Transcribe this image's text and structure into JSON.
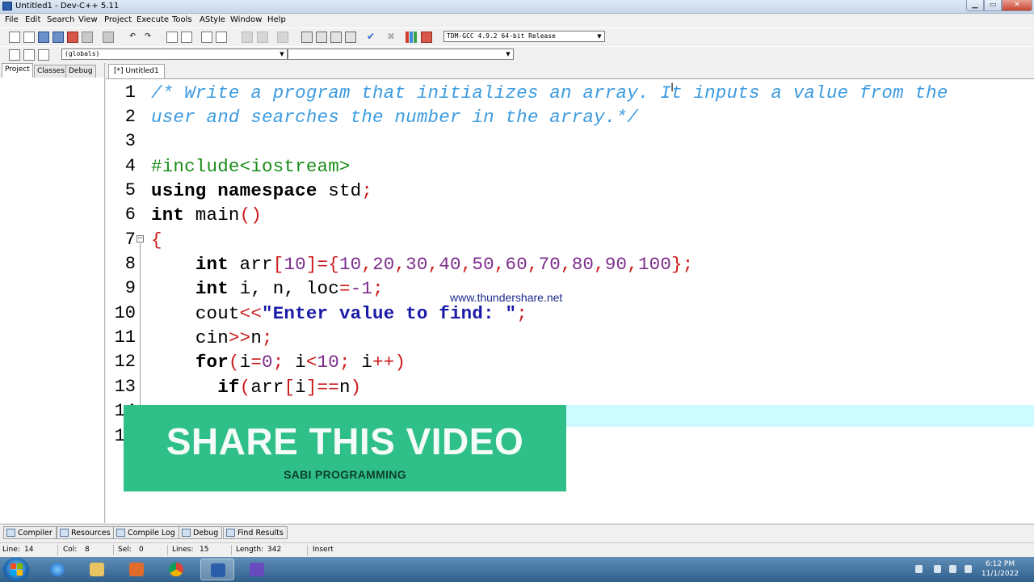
{
  "window": {
    "title": "Untitled1 - Dev-C++ 5.11"
  },
  "menu": [
    "File",
    "Edit",
    "Search",
    "View",
    "Project",
    "Execute",
    "Tools",
    "AStyle",
    "Window",
    "Help"
  ],
  "toolbar": {
    "compiler_select": "TDM-GCC 4.9.2 64-bit Release",
    "scope_select": "(globals)",
    "function_select": ""
  },
  "left_panel": {
    "tabs": [
      "Project",
      "Classes",
      "Debug"
    ]
  },
  "editor": {
    "tab_label": "[*] Untitled1",
    "line_numbers": [
      "1",
      "2",
      "3",
      "4",
      "5",
      "6",
      "7",
      "8",
      "9",
      "10",
      "11",
      "12",
      "13",
      "14",
      "15"
    ],
    "code": {
      "l1": "/* Write a program that initializes an array. It inputs a value from the",
      "l2": "user and searches the number in the array.*/",
      "l4": "#include<iostream>",
      "l5_kw": "using namespace",
      "l5_rest": " std",
      "l6_kw": "int",
      "l6_rest": " main",
      "l8_kw": "int",
      "l8_name": " arr",
      "l8_size": "10",
      "l8_values": [
        "10",
        "20",
        "30",
        "40",
        "50",
        "60",
        "70",
        "80",
        "90",
        "100"
      ],
      "l9_kw": "int",
      "l9_vars": " i, n, loc",
      "l9_val": "-1",
      "l10_name": "cout",
      "l10_str": "\"Enter value to find: \"",
      "l11_name": "cin",
      "l11_var": "n",
      "l12_kw": "for",
      "l12_a": "i",
      "l12_b": "0",
      "l12_c": " i",
      "l12_d": "10",
      "l12_e": " i",
      "l13_kw": "if",
      "l13_a": "arr",
      "l13_b": "i",
      "l13_c": "n"
    }
  },
  "overlay": {
    "watermark": "www.thundershare.net",
    "share_title": "SHARE THIS VIDEO",
    "share_subtitle": "SABI PROGRAMMING"
  },
  "bottom_tabs": [
    "Compiler",
    "Resources",
    "Compile Log",
    "Debug",
    "Find Results"
  ],
  "status": {
    "line_label": "Line:",
    "line": "14",
    "col_label": "Col:",
    "col": "8",
    "sel_label": "Sel:",
    "sel": "0",
    "lines_label": "Lines:",
    "lines": "15",
    "length_label": "Length:",
    "length": "342",
    "mode": "Insert"
  },
  "taskbar": {
    "time": "6:12 PM",
    "date": "11/1/2022"
  }
}
